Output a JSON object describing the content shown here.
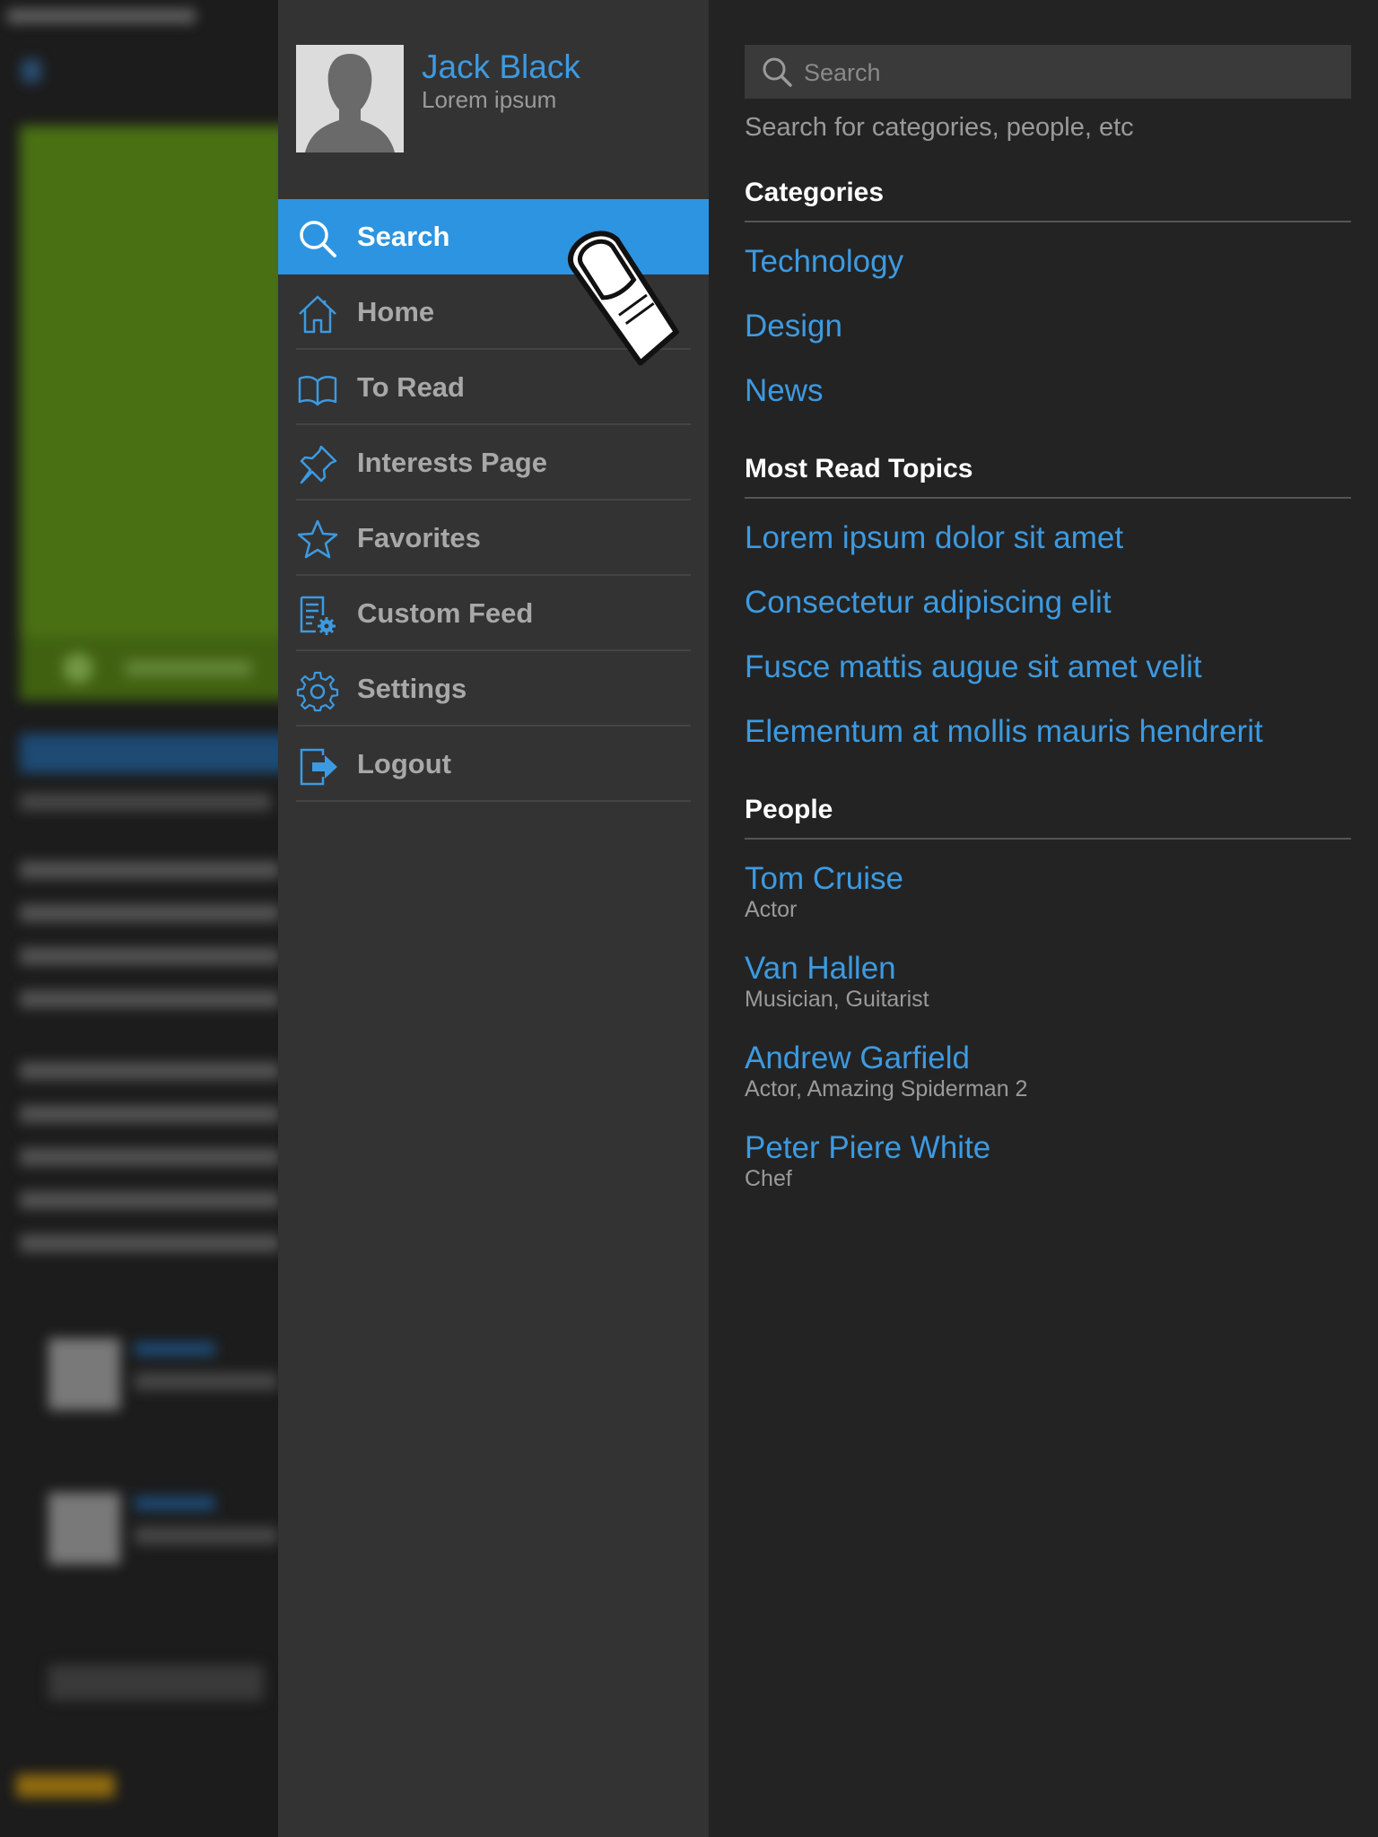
{
  "profile": {
    "name": "Jack Black",
    "subtitle": "Lorem ipsum"
  },
  "menu": {
    "items": [
      {
        "label": "Search",
        "icon": "search-icon",
        "active": true
      },
      {
        "label": "Home",
        "icon": "home-icon",
        "active": false
      },
      {
        "label": "To Read",
        "icon": "book-icon",
        "active": false
      },
      {
        "label": "Interests Page",
        "icon": "pin-icon",
        "active": false
      },
      {
        "label": "Favorites",
        "icon": "star-icon",
        "active": false
      },
      {
        "label": "Custom Feed",
        "icon": "feed-settings-icon",
        "active": false
      },
      {
        "label": "Settings",
        "icon": "gear-icon",
        "active": false
      },
      {
        "label": "Logout",
        "icon": "logout-icon",
        "active": false
      }
    ]
  },
  "search": {
    "placeholder": "Search",
    "value": "",
    "hint": "Search for categories, people, etc"
  },
  "categories": {
    "title": "Categories",
    "items": [
      "Technology",
      "Design",
      "News"
    ]
  },
  "topics": {
    "title": "Most Read Topics",
    "items": [
      "Lorem ipsum dolor sit amet",
      "Consectetur adipiscing elit",
      "Fusce mattis augue sit amet velit",
      "Elementum at mollis mauris hendrerit"
    ]
  },
  "people": {
    "title": "People",
    "items": [
      {
        "name": "Tom Cruise",
        "role": "Actor"
      },
      {
        "name": "Van Hallen",
        "role": "Musician, Guitarist"
      },
      {
        "name": "Andrew Garfield",
        "role": "Actor, Amazing Spiderman 2"
      },
      {
        "name": "Peter Piere White",
        "role": "Chef"
      }
    ]
  },
  "colors": {
    "accent": "#2d94e1",
    "link": "#3d9ae0",
    "menu_bg": "#333333",
    "panel_bg": "#232323"
  }
}
